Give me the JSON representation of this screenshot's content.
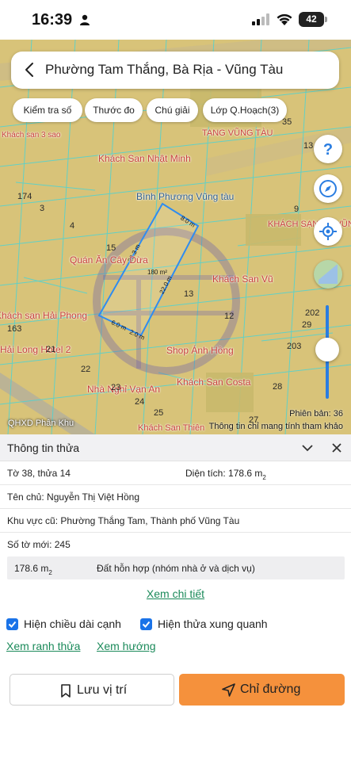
{
  "status_bar": {
    "time": "16:39",
    "battery": "42"
  },
  "header": {
    "title": "Phường Tam Thắng, Bà Rịa - Vũng Tàu"
  },
  "chips": [
    {
      "label": "Kiểm tra số"
    },
    {
      "label": "Thước đo"
    },
    {
      "label": "Chú giải"
    },
    {
      "label": "Lớp Q.Hoạch(3)"
    }
  ],
  "map": {
    "pois": [
      {
        "label": "Khách San Nhật Minh",
        "color": "#c8403a"
      },
      {
        "label": "Bình Phương Vũng tàu",
        "color": "#2f5e8f"
      },
      {
        "label": "Quán Ăn Cây Dừa",
        "color": "#c8403a"
      },
      {
        "label": "Khách San Vũ",
        "color": "#c8403a"
      },
      {
        "label": "Shop Ánh Hồng",
        "color": "#c8403a"
      },
      {
        "label": "Khách San Costa",
        "color": "#c8403a"
      },
      {
        "label": "Nhà Nghỉ Vạn An",
        "color": "#c8403a"
      },
      {
        "label": "Khách San Thiên",
        "color": "#c8403a"
      },
      {
        "label": "Khách sạn Hải Phong",
        "color": "#c8403a"
      },
      {
        "label": "Hải Long Hotel 2",
        "color": "#c8403a"
      },
      {
        "label": "Khách sạn 3 sao",
        "color": "#c8403a"
      },
      {
        "label": "TANG VŨNG TÀU",
        "color": "#c8403a"
      },
      {
        "label": "KHÁCH SẠN RẺ VŨNG",
        "color": "#c8403a"
      }
    ],
    "parcel_numbers": [
      "174",
      "3",
      "4",
      "15",
      "13",
      "12",
      "35",
      "13",
      "9",
      "202",
      "29",
      "203",
      "163",
      "21",
      "22",
      "23",
      "24",
      "25",
      "28",
      "27",
      "29"
    ],
    "parcel": {
      "area_label": "180 m²",
      "edges": [
        "8.0 m",
        "22.3 m",
        "22.0 m",
        "6.0 m",
        "2.0 m"
      ]
    },
    "footer_left": "QHXD Phân Khu",
    "version": "Phiên bản: 36",
    "disclaimer": "Thông tin chỉ mang tính tham khảo"
  },
  "info": {
    "title": "Thông tin thửa",
    "to_thua": "Tờ 38, thửa 14",
    "dien_tich_label": "Diện tích:",
    "dien_tich_value": "178.6 m",
    "dien_tich_unit": "2",
    "ten_chu": "Tên chủ: Nguyễn Thị Việt Hồng",
    "khu_vuc_cu": "Khu vực cũ: Phường Thắng Tam, Thành phố Vũng Tàu",
    "so_to_moi": "Số tờ mới: 245",
    "land_area": "178.6 m",
    "land_area_unit": "2",
    "land_type": "Đất hỗn hợp (nhóm nhà ở và dịch vụ)",
    "view_detail": "Xem chi tiết",
    "check_edges": "Hiện chiều dài cạnh",
    "check_neighbors": "Hiện thửa xung quanh",
    "link_boundary": "Xem ranh thửa",
    "link_direction": "Xem hướng",
    "save_label": "Lưu vị trí",
    "route_label": "Chỉ đường"
  }
}
